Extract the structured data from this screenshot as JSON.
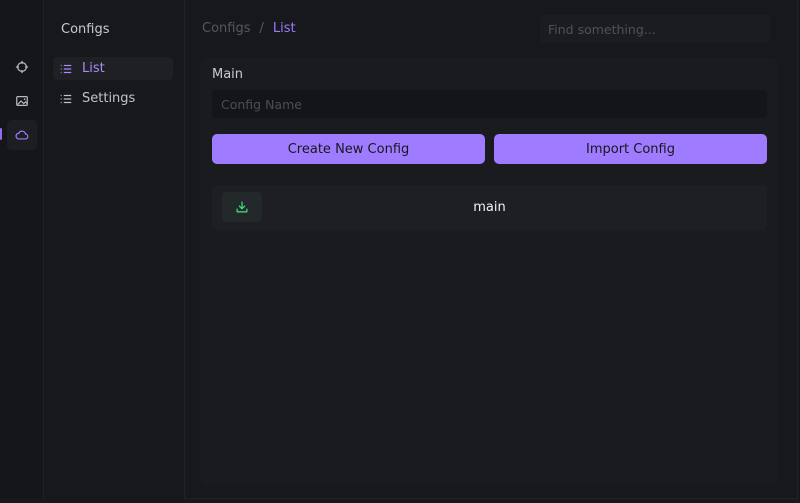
{
  "rail": {
    "items": [
      {
        "name": "crosshair-icon",
        "active": false
      },
      {
        "name": "image-icon",
        "active": false
      },
      {
        "name": "cloud-icon",
        "active": true
      }
    ]
  },
  "sidebar": {
    "title": "Configs",
    "items": [
      {
        "label": "List",
        "icon": "list-icon",
        "active": true
      },
      {
        "label": "Settings",
        "icon": "list-icon",
        "active": false
      }
    ]
  },
  "header": {
    "breadcrumb": [
      "Configs",
      "List"
    ],
    "separator": "/",
    "search_placeholder": "Find something..."
  },
  "main": {
    "title": "Main",
    "config_name_placeholder": "Config Name",
    "config_name_value": "",
    "create_button": "Create New Config",
    "import_button": "Import Config",
    "configs": [
      {
        "name": "main",
        "action_icon": "download-icon"
      }
    ]
  },
  "colors": {
    "accent": "#9f7bff",
    "accent_text": "#a98bff",
    "success": "#3fd47a",
    "background": "#17181b",
    "panel": "#1a1b1f"
  }
}
